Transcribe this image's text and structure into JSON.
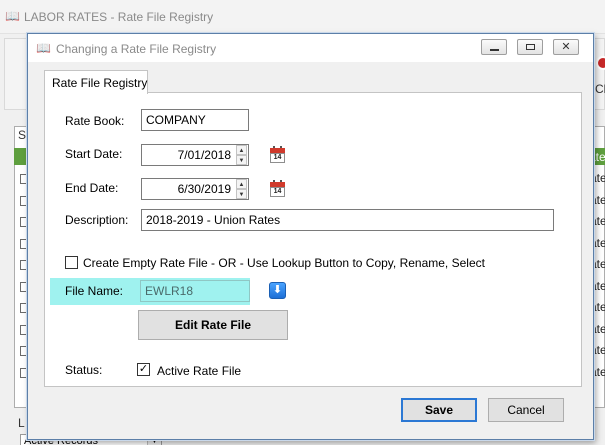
{
  "background_window": {
    "title": "LABOR RATES - Rate File Registry",
    "close_label": "Cl",
    "grid_header": "S",
    "green_row_text": "ate",
    "row_texts": [
      "ate",
      "ate",
      "ate",
      "ate",
      "ate",
      "ate",
      "ate",
      "ate",
      "ate",
      "ate"
    ],
    "bottom_label": "L",
    "filter_combo": "Active Records"
  },
  "dialog": {
    "title": "Changing a Rate File Registry",
    "tab_label": "Rate File Registry",
    "rate_book": {
      "label": "Rate Book:",
      "value": "COMPANY"
    },
    "start_date": {
      "label": "Start Date:",
      "value": "7/01/2018"
    },
    "end_date": {
      "label": "End Date:",
      "value": "6/30/2019"
    },
    "description": {
      "label": "Description:",
      "value": "2018-2019 - Union Rates"
    },
    "create_empty": {
      "label": "Create Empty Rate File - OR - Use Lookup Button to Copy, Rename, Select",
      "checked": false
    },
    "file_name": {
      "label": "File Name:",
      "value": "EWLR18"
    },
    "edit_button": "Edit Rate File",
    "status": {
      "label": "Status:",
      "checkbox_label": "Active Rate File",
      "checked": true
    },
    "save_button": "Save",
    "cancel_button": "Cancel",
    "calendar_day": "14",
    "checkmark": "✓",
    "lookup_glyph": "⬇",
    "close_glyph": "✕"
  },
  "colors": {
    "highlight": "#9ff2ef",
    "green_row": "#5e9f3e",
    "default_border": "#2b78d4"
  }
}
